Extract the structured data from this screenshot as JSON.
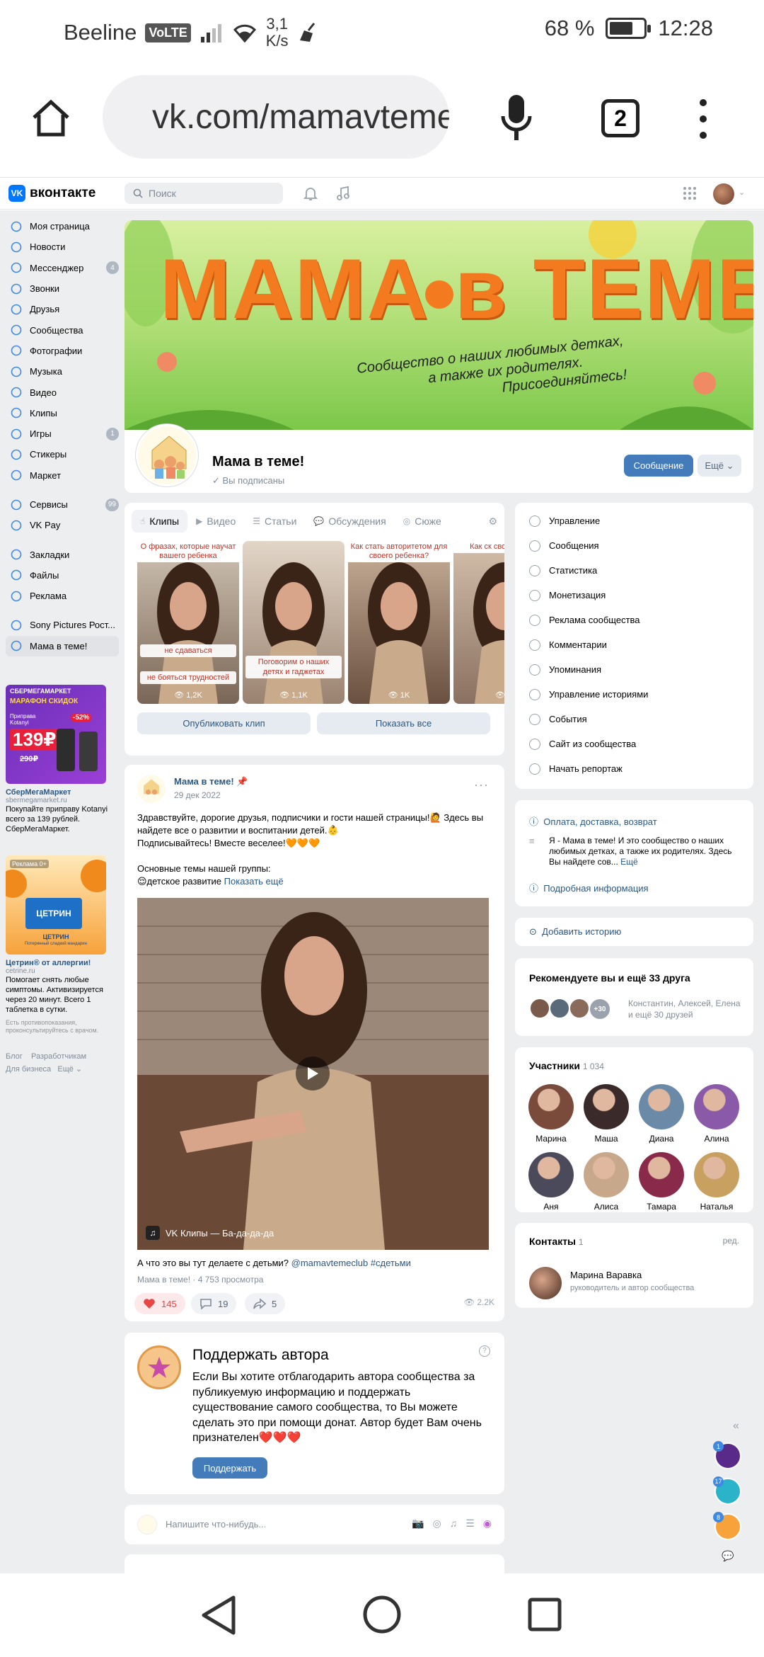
{
  "status_bar": {
    "carrier": "Beeline",
    "volte": "VoLTE",
    "speed_value": "3,1",
    "speed_unit": "K/s",
    "battery_text": "68 %",
    "battery_level": 0.68,
    "time": "12:28"
  },
  "browser": {
    "url": "vk.com/mamavtemeclub",
    "tab_count": "2"
  },
  "vk_header": {
    "logo_text": "вконтакте",
    "search_placeholder": "Поиск"
  },
  "left_nav": {
    "items": [
      {
        "label": "Моя страница",
        "icon": "user-icon",
        "count": ""
      },
      {
        "label": "Новости",
        "icon": "news-icon",
        "count": ""
      },
      {
        "label": "Мессенджер",
        "icon": "message-icon",
        "count": "4"
      },
      {
        "label": "Звонки",
        "icon": "phone-icon",
        "count": ""
      },
      {
        "label": "Друзья",
        "icon": "friends-icon",
        "count": ""
      },
      {
        "label": "Сообщества",
        "icon": "community-icon",
        "count": ""
      },
      {
        "label": "Фотографии",
        "icon": "photo-icon",
        "count": ""
      },
      {
        "label": "Музыка",
        "icon": "music-icon",
        "count": ""
      },
      {
        "label": "Видео",
        "icon": "video-icon",
        "count": ""
      },
      {
        "label": "Клипы",
        "icon": "clips-icon",
        "count": ""
      },
      {
        "label": "Игры",
        "icon": "games-icon",
        "count": "1"
      },
      {
        "label": "Стикеры",
        "icon": "sticker-icon",
        "count": ""
      },
      {
        "label": "Маркет",
        "icon": "market-icon",
        "count": ""
      }
    ],
    "items2": [
      {
        "label": "Сервисы",
        "icon": "services-icon",
        "count": "99"
      },
      {
        "label": "VK Pay",
        "icon": "pay-icon",
        "count": ""
      }
    ],
    "items3": [
      {
        "label": "Закладки",
        "icon": "bookmark-icon"
      },
      {
        "label": "Файлы",
        "icon": "file-icon"
      },
      {
        "label": "Реклама",
        "icon": "ads-icon"
      }
    ],
    "items4": [
      {
        "label": "Sony Pictures Рост..."
      },
      {
        "label": "Мама в теме!"
      }
    ]
  },
  "ads": [
    {
      "img_badge": "СБЕРМЕГАМАРКЕТ",
      "img_line": "МАРАФОН СКИДОК",
      "img_price": "139₽",
      "img_old_price": "290₽",
      "img_discount": "-52%",
      "img_brand": "Приправа Kotanyi",
      "title": "СберМегаМаркет",
      "domain": "sbermegamarket.ru",
      "text": "Покупайте приправу Kotanyi всего за 139 рублей. СберМегаМаркет."
    },
    {
      "img_badge": "Реклама 0+",
      "img_brand": "ЦЕТРИН",
      "img_line": "ЦЕТРИН",
      "img_sub": "Потерянный сладкий мандарин",
      "title": "Цетрин® от аллергии!",
      "domain": "cetrine.ru",
      "text": "Помогает снять любые симптомы. Активизируется через 20 минут. Всего 1 таблетка в сутки.",
      "note": "Есть противопоказания, проконсультируйтесь с врачом."
    }
  ],
  "footer_links": [
    "Блог",
    "Разработчикам",
    "Для бизнеса",
    "Ещё ⌄"
  ],
  "community": {
    "cover_title": "МАМА в ТЕМЕ!",
    "cover_subtitle_1": "Сообщество о наших любимых детках,",
    "cover_subtitle_2": "а также их родителях.",
    "cover_subtitle_3": "Присоединяйтесь!",
    "name": "Мама в теме!",
    "subscribed": "Вы подписаны",
    "btn_message": "Сообщение",
    "btn_more": "Ещё ⌄"
  },
  "clips_block": {
    "tabs": [
      "Клипы",
      "Видео",
      "Статьи",
      "Обсуждения",
      "Сюже"
    ],
    "clips": [
      {
        "caption": "О фразах, которые научат вашего ребенка",
        "overlay_1": "не сдаваться",
        "overlay_2": "не бояться трудностей",
        "views": "1,2K"
      },
      {
        "caption": "",
        "overlay_1": "Поговорим о наших детях и гаджетах",
        "overlay_2": "",
        "views": "1,1K"
      },
      {
        "caption": "Как стать авторитетом для своего ребенка?",
        "overlay_1": "",
        "overlay_2": "",
        "views": "1K"
      },
      {
        "caption": "Как ск своему ребе",
        "overlay_1": "",
        "overlay_2": "",
        "views": "1,"
      }
    ],
    "btn_publish": "Опубликовать клип",
    "btn_show_all": "Показать все"
  },
  "post": {
    "author": "Мама в теме!",
    "date": "29 дек 2022",
    "text_1": "Здравствуйте, дорогие друзья, подписчики и гости нашей страницы!🙋 Здесь вы найдете все о развитии и воспитании детей.👶",
    "text_2": "Подписывайтесь! Вместе веселее!🧡🧡🧡",
    "text_3": "Основные темы нашей группы:",
    "text_4": "😌детское развитие",
    "show_more": "Показать ещё",
    "video_label": "VK Клипы — Ба-да-да-да",
    "caption": "А что это вы тут делаете с детьми?",
    "caption_tags": "@mamavtemeclub #сдетьми",
    "meta": "Мама в теме! · 4 753 просмотра",
    "likes": "145",
    "comments": "19",
    "shares": "5",
    "views": "2.2K"
  },
  "donate": {
    "title": "Поддержать автора",
    "text": "Если Вы хотите отблагодарить автора сообщества за публикуемую информацию и поддержать существование самого сообщества, то Вы можете сделать это при помощи донат. Автор будет Вам очень признателен❤️❤️❤️",
    "button": "Поддержать"
  },
  "composer": {
    "placeholder": "Напишите что-нибудь..."
  },
  "admin_menu": [
    "Управление",
    "Сообщения",
    "Статистика",
    "Монетизация",
    "Реклама сообщества",
    "Комментарии",
    "Упоминания",
    "Управление историями",
    "События",
    "Сайт из сообщества",
    "Начать репортаж"
  ],
  "info": {
    "delivery": "Оплата, доставка, возврат",
    "description": "Я - Мама в теме! И это сообщество о наших любимых детках, а также их родителях. Здесь Вы найдете сов...",
    "more": "Ещё",
    "details": "Подробная информация"
  },
  "add_story": "Добавить историю",
  "recommend": {
    "title": "Рекомендуете вы и ещё 33 друга",
    "plus": "+30",
    "names": "Константин, Алексей, Елена и ещё 30 друзей"
  },
  "members": {
    "title": "Участники",
    "count": "1 034",
    "people": [
      "Марина",
      "Маша",
      "Диана",
      "Алина",
      "Аня",
      "Алиса",
      "Тамара",
      "Наталья"
    ]
  },
  "contacts": {
    "title": "Контакты",
    "count": "1",
    "edit": "ред.",
    "name": "Марина Варавка",
    "role": "руководитель и автор сообщества"
  },
  "floating": {
    "collapse": "«",
    "badges": [
      "1",
      "17",
      "8"
    ]
  }
}
